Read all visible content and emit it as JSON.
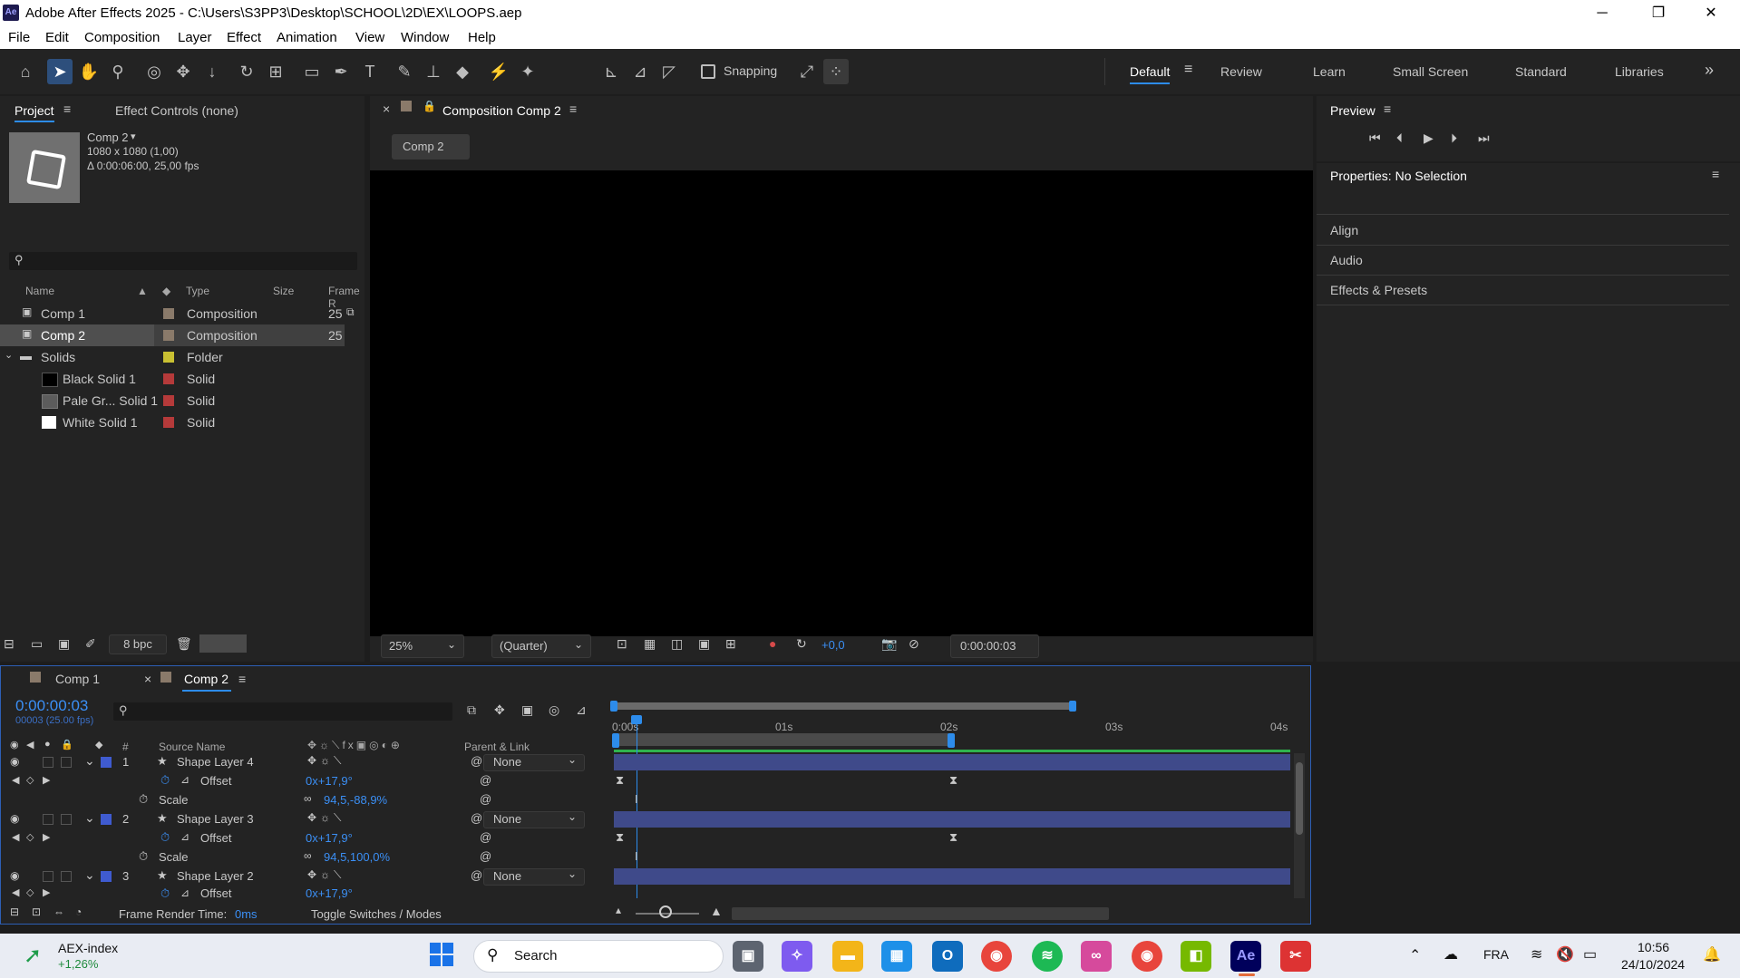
{
  "window": {
    "title": "Adobe After Effects 2025 - C:\\Users\\S3PP3\\Desktop\\SCHOOL\\2D\\EX\\LOOPS.aep",
    "logo": "Ae"
  },
  "menu": [
    "File",
    "Edit",
    "Composition",
    "Layer",
    "Effect",
    "Animation",
    "View",
    "Window",
    "Help"
  ],
  "toolbar": {
    "snapping_label": "Snapping",
    "workspaces": [
      "Default",
      "Review",
      "Learn",
      "Small Screen",
      "Standard",
      "Libraries"
    ],
    "more_label": "»"
  },
  "project": {
    "tab_project": "Project",
    "tab_effect": "Effect Controls (none)",
    "comp_name": "Comp 2",
    "comp_dims": "1080 x 1080 (1,00)",
    "comp_dur": "Δ 0:00:06:00, 25,00 fps",
    "search_placeholder": "",
    "cols": {
      "name": "Name",
      "type": "Type",
      "size": "Size",
      "frame": "Frame R"
    },
    "items": [
      {
        "name": "Comp 1",
        "type": "Composition",
        "frame": "25",
        "color": "#8a7a6a"
      },
      {
        "name": "Comp 2",
        "type": "Composition",
        "frame": "25",
        "color": "#8a7a6a"
      },
      {
        "name": "Solids",
        "type": "Folder",
        "frame": "",
        "color": "#c9c032"
      },
      {
        "name": "Black Solid 1",
        "type": "Solid",
        "frame": "",
        "color": "#b53a3a"
      },
      {
        "name": "Pale Gr... Solid 1",
        "type": "Solid",
        "frame": "",
        "color": "#b53a3a"
      },
      {
        "name": "White Solid 1",
        "type": "Solid",
        "frame": "",
        "color": "#b53a3a"
      }
    ],
    "bpc": "8 bpc"
  },
  "comp_viewer": {
    "tab": "Composition Comp 2",
    "breadcrumb": "Comp 2",
    "zoom": "25%",
    "resolution": "(Quarter)",
    "exposure": "+0,0",
    "timecode": "0:00:00:03"
  },
  "preview": {
    "title": "Preview"
  },
  "properties": {
    "title": "Properties: No Selection"
  },
  "side_panels": [
    "Align",
    "Audio",
    "Effects & Presets"
  ],
  "timeline": {
    "tabs": [
      "Comp 1",
      "Comp 2"
    ],
    "timecode": "0:00:00:03",
    "frames": "00003 (25.00 fps)",
    "col_source": "Source Name",
    "col_parent": "Parent & Link",
    "col_num": "#",
    "ruler": [
      "0:00s",
      "01s",
      "02s",
      "03s",
      "04s"
    ],
    "layers": [
      {
        "num": "1",
        "name": "Shape Layer 4",
        "parent": "None"
      },
      {
        "prop": "Offset",
        "value": "0x+17,9°"
      },
      {
        "prop": "Scale",
        "value": "94,5,-88,9%"
      },
      {
        "num": "2",
        "name": "Shape Layer 3",
        "parent": "None"
      },
      {
        "prop": "Offset",
        "value": "0x+17,9°"
      },
      {
        "prop": "Scale",
        "value": "94,5,100,0%"
      },
      {
        "num": "3",
        "name": "Shape Layer 2",
        "parent": "None"
      },
      {
        "prop": "Offset",
        "value": "0x+17,9°"
      }
    ],
    "render_label": "Frame Render Time:",
    "render_value": "0ms",
    "toggle_label": "Toggle Switches / Modes"
  },
  "taskbar": {
    "stock_name": "AEX-index",
    "stock_change": "+1,26%",
    "search": "Search",
    "lang": "FRA",
    "time": "10:56",
    "date": "24/10/2024"
  }
}
